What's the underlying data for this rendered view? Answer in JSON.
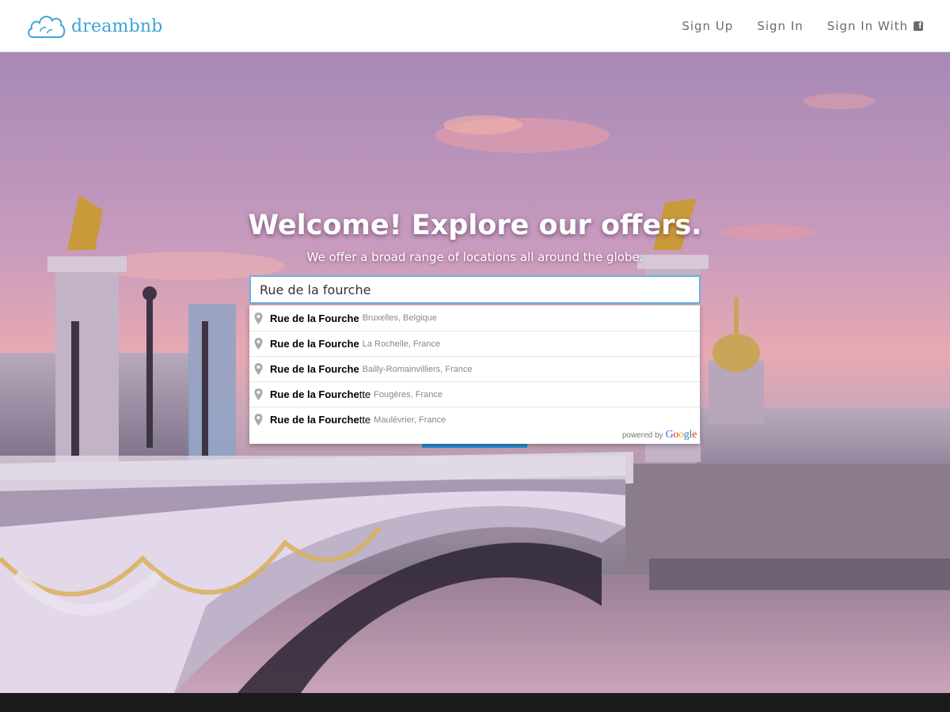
{
  "header": {
    "logo_text": "dreambnb",
    "nav": {
      "sign_up": "Sign Up",
      "sign_in": "Sign In",
      "sign_in_with": "Sign In With"
    }
  },
  "hero": {
    "title": "Welcome! Explore our offers.",
    "subtitle": "We offer a broad range of locations all around the globe."
  },
  "search": {
    "value": "Rue de la fourche"
  },
  "autocomplete": {
    "items": [
      {
        "match": "Rue de la Fourche",
        "rest": "",
        "secondary": "Bruxelles, Belgique"
      },
      {
        "match": "Rue de la Fourche",
        "rest": "",
        "secondary": "La Rochelle, France"
      },
      {
        "match": "Rue de la Fourche",
        "rest": "",
        "secondary": "Bailly-Romainvilliers, France"
      },
      {
        "match": "Rue de la Fourche",
        "rest": "tte",
        "secondary": "Fougères, France"
      },
      {
        "match": "Rue de la Fourche",
        "rest": "tte",
        "secondary": "Maulévrier, France"
      }
    ],
    "powered_by": "powered by",
    "google": "Google"
  },
  "colors": {
    "brand": "#3fa3d8",
    "nav_text": "#6b6b6b",
    "input_focus_border": "#6eaee0",
    "button_blue": "#2a8ccf"
  },
  "icons": [
    "cloud-logo-icon",
    "facebook-icon",
    "map-pin-icon"
  ]
}
